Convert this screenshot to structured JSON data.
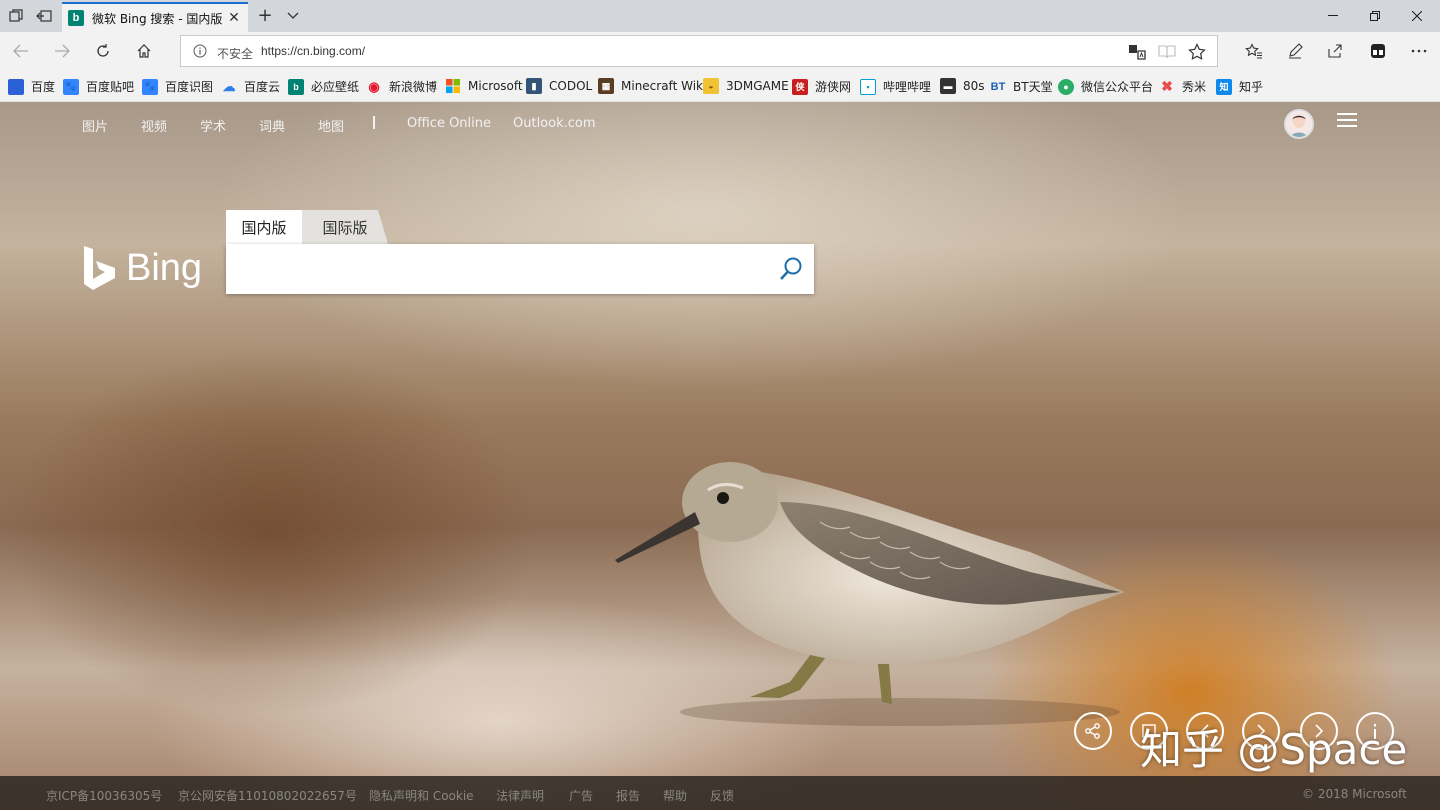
{
  "browser": {
    "tab": {
      "title": "微软 Bing 搜索 - 国内版",
      "favicon": "bing-favicon"
    },
    "address": {
      "security_label": "不安全",
      "url": "https://cn.bing.com/"
    },
    "favorites": [
      {
        "label": "百度",
        "icon": "baidu-icon",
        "color": "#2f5fd8"
      },
      {
        "label": "百度贴吧",
        "icon": "tieba-icon",
        "color": "#3385ff"
      },
      {
        "label": "百度识图",
        "icon": "shitu-icon",
        "color": "#3385ff"
      },
      {
        "label": "百度云",
        "icon": "baiduyun-icon",
        "color": "#2f7ee8"
      },
      {
        "label": "必应壁纸",
        "icon": "bing-wallpaper-icon",
        "color": "#008373"
      },
      {
        "label": "新浪微博",
        "icon": "weibo-icon",
        "color": "#e6162d"
      },
      {
        "label": "Microsoft",
        "icon": "microsoft-icon",
        "color": "#f25022"
      },
      {
        "label": "CODOL",
        "icon": "codol-icon",
        "color": "#335577"
      },
      {
        "label": "Minecraft Wiki",
        "icon": "minecraft-icon",
        "color": "#5a3d22"
      },
      {
        "label": "3DMGAME",
        "icon": "3dm-icon",
        "color": "#e0a000"
      },
      {
        "label": "游侠网",
        "icon": "ali213-icon",
        "color": "#c81e1e"
      },
      {
        "label": "哔哩哔哩",
        "icon": "bilibili-icon",
        "color": "#00a1d6"
      },
      {
        "label": "80s",
        "icon": "80s-icon",
        "color": "#333333"
      },
      {
        "label": "BT天堂",
        "icon": "bt-icon",
        "color": "#1f5fb8"
      },
      {
        "label": "微信公众平台",
        "icon": "wechat-icon",
        "color": "#2aae67"
      },
      {
        "label": "秀米",
        "icon": "xiumi-icon",
        "color": "#e84d4d"
      },
      {
        "label": "知乎",
        "icon": "zhihu-icon",
        "color": "#0f88eb"
      }
    ]
  },
  "bing": {
    "topnav": [
      "图片",
      "视频",
      "学术",
      "词典",
      "地图",
      "Office Online",
      "Outlook.com"
    ],
    "logo_text": "Bing",
    "scope_tabs": [
      "国内版",
      "国际版"
    ],
    "search": {
      "value": "",
      "placeholder": ""
    },
    "watermark": "知乎 @Space",
    "footer": [
      "京ICP备10036305号",
      "京公网安备11010802022657号",
      "隐私声明和 Cookie",
      "法律声明",
      "广告",
      "报告",
      "帮助",
      "反馈",
      "© 2018 Microsoft"
    ]
  }
}
